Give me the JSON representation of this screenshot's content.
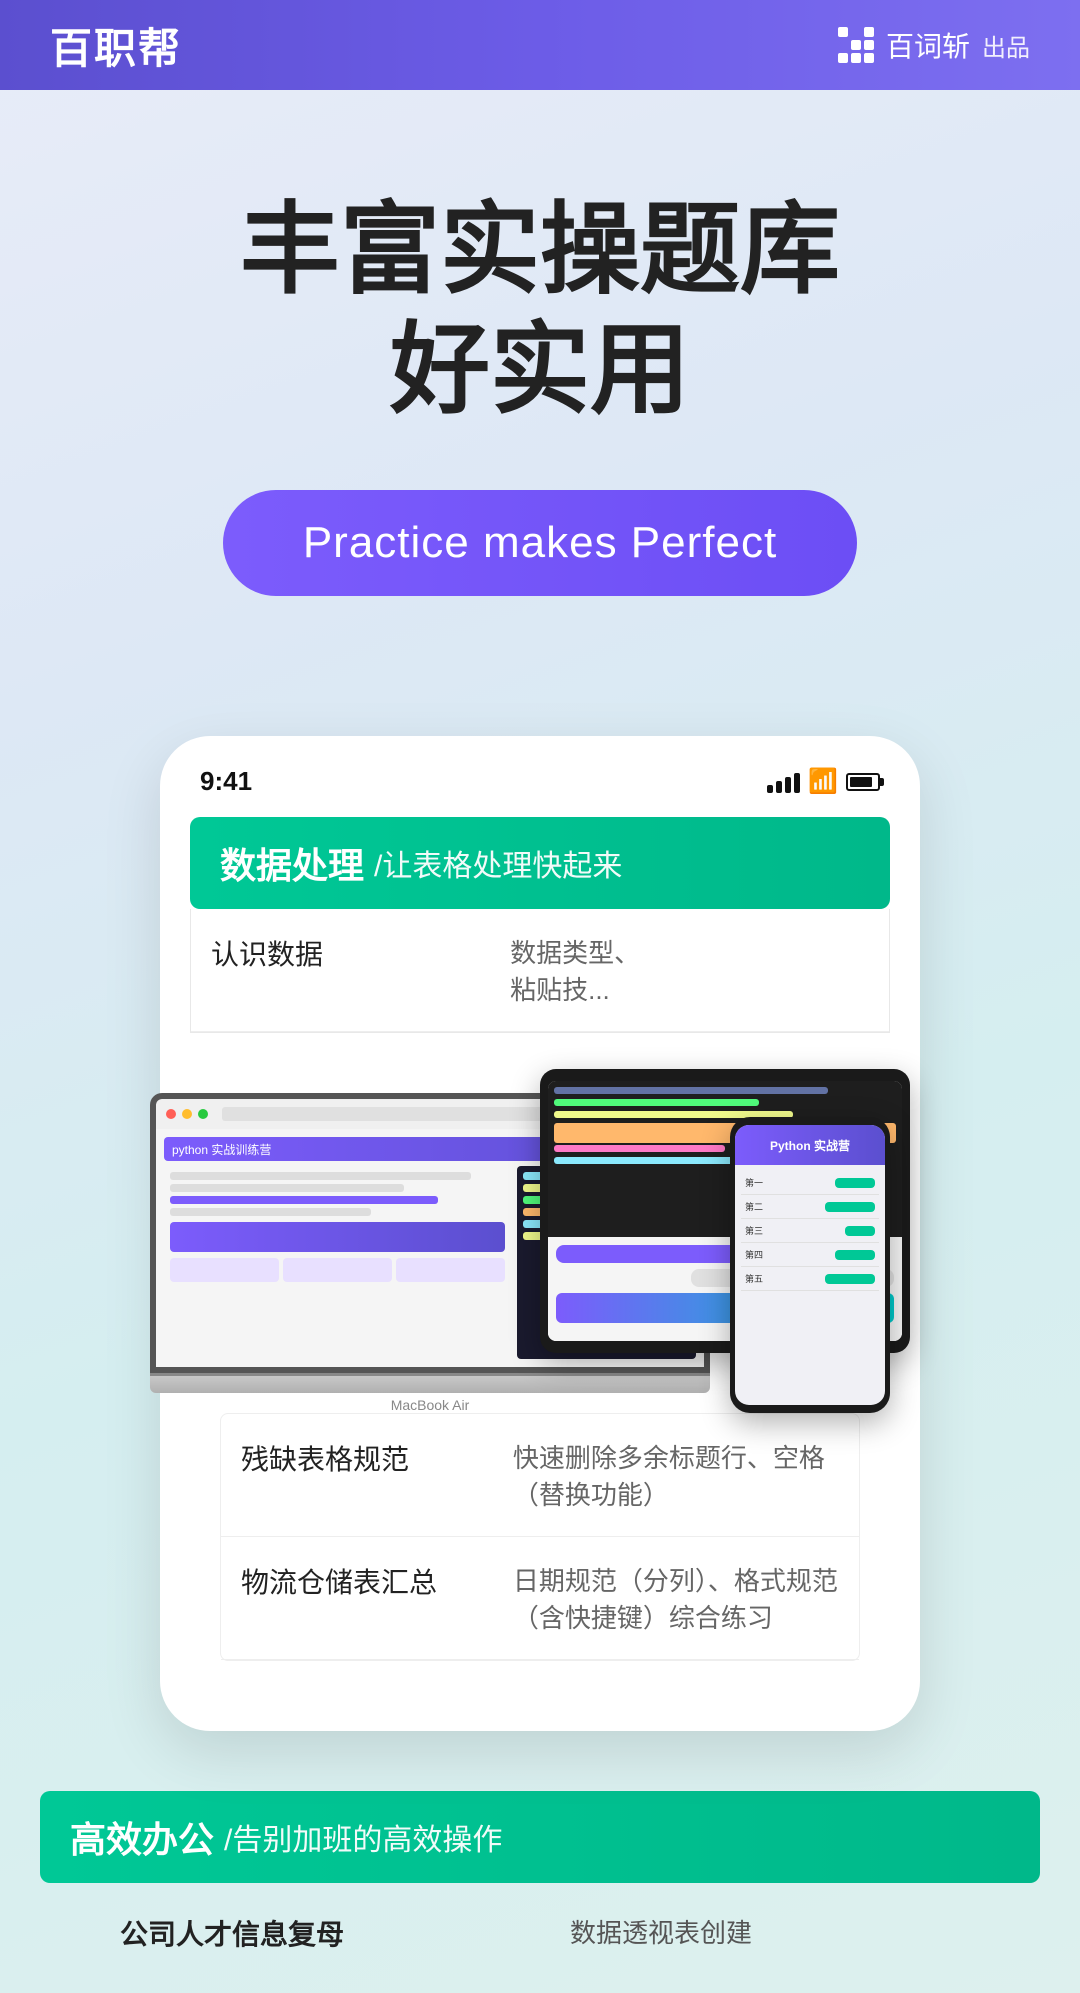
{
  "header": {
    "logo": "百职帮",
    "brand_icon_label": "百词斩",
    "brand_suffix": "出品"
  },
  "hero": {
    "title_line1": "丰富实操题库",
    "title_line2": "好实用",
    "practice_button": "Practice makes Perfect"
  },
  "phone_mockup": {
    "status_time": "9:41",
    "category1": {
      "title_bold": "数据处理",
      "title_light": "/让表格处理快起来",
      "rows": [
        {
          "left": "认识数据",
          "right": "数据类型、粘贴技..."
        },
        {
          "left": "残缺表格规范",
          "right": "快速删除多余标题行、空格（替换功能）"
        },
        {
          "left": "物流仓储表汇总",
          "right": "日期规范（分列）、格式规范（含快捷键）综合练习"
        }
      ]
    },
    "category2": {
      "title_bold": "高效办公",
      "title_light": "/告别加班的高效操作",
      "rows": [
        {
          "left": "公司人才信息复母",
          "right": "数据透视表创建"
        }
      ]
    }
  },
  "laptop": {
    "label": "MacBook Air",
    "banner_text": "python 实战训练营"
  },
  "icons": {
    "signal": "▌▌▌▌",
    "wifi": "WiFi",
    "battery": "■"
  }
}
